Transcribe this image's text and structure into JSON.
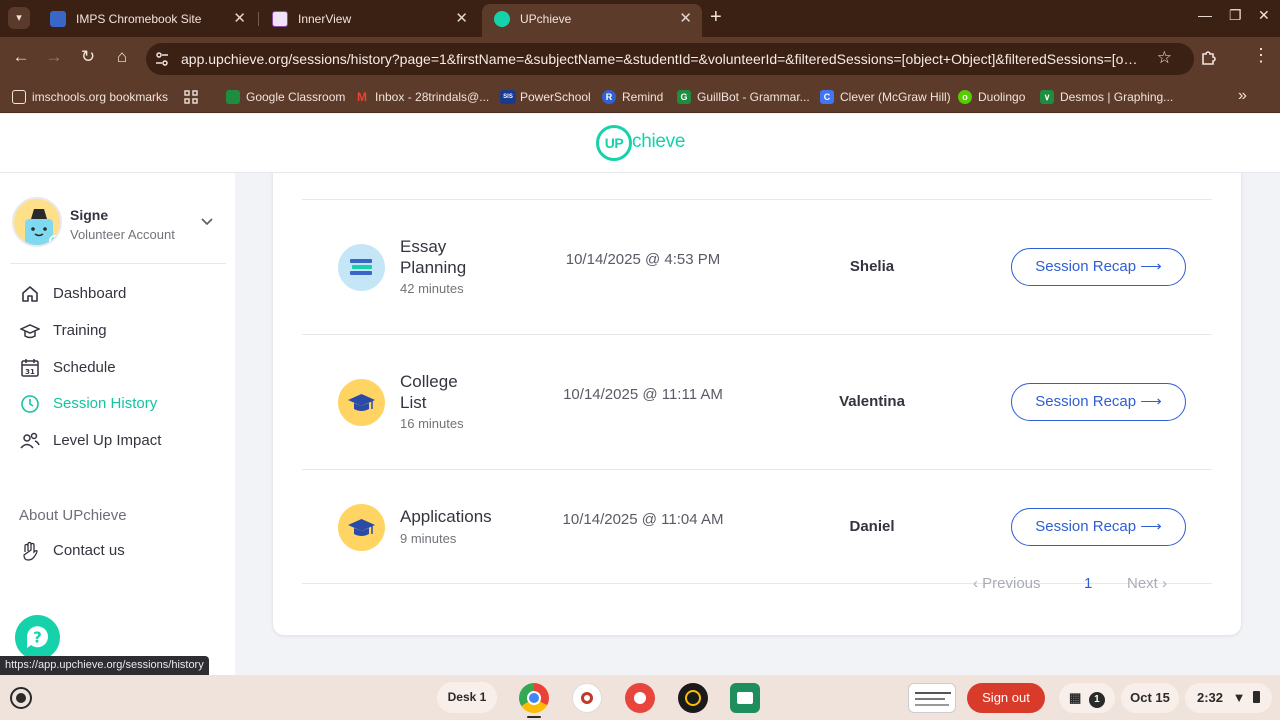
{
  "browser": {
    "tabs": [
      {
        "title": "IMPS Chromebook Site",
        "active": false
      },
      {
        "title": "InnerView",
        "active": false
      },
      {
        "title": "UPchieve",
        "active": true
      }
    ],
    "url": "app.upchieve.org/sessions/history?page=1&firstName=&subjectName=&studentId=&volunteerId=&filteredSessions=[object+Object]&filteredSessions=[object+Obje...",
    "bookmarks": [
      {
        "label": "imschools.org bookmarks",
        "icon": "folder-icon"
      },
      {
        "label": "Google Classroom",
        "icon": "classroom-icon",
        "color": "#1e8e3e"
      },
      {
        "label": "Inbox - 28trindals@...",
        "icon": "gmail-icon",
        "color": "#ea4335"
      },
      {
        "label": "PowerSchool",
        "icon": "powerschool-icon",
        "color": "#1a3a8f"
      },
      {
        "label": "Remind",
        "icon": "remind-icon",
        "color": "#2c62d6"
      },
      {
        "label": "GuillBot - Grammar...",
        "icon": "guillbot-icon",
        "color": "#1e8e3e"
      },
      {
        "label": "Clever (McGraw Hill)",
        "icon": "clever-icon",
        "color": "#4274f6"
      },
      {
        "label": "Duolingo",
        "icon": "duolingo-icon",
        "color": "#58cc02"
      },
      {
        "label": "Desmos | Graphing...",
        "icon": "desmos-icon",
        "color": "#1e8e3e"
      }
    ],
    "status_url": "https://app.upchieve.org/sessions/history"
  },
  "header": {
    "logo_up": "UP",
    "logo_word": "chieve"
  },
  "profile": {
    "name": "Signe",
    "role": "Volunteer Account"
  },
  "nav": [
    {
      "label": "Dashboard",
      "icon": "home-icon",
      "active": false
    },
    {
      "label": "Training",
      "icon": "graduation-cap-icon",
      "active": false
    },
    {
      "label": "Schedule",
      "icon": "calendar-icon",
      "active": false
    },
    {
      "label": "Session History",
      "icon": "clock-icon",
      "active": true
    },
    {
      "label": "Level Up Impact",
      "icon": "people-icon",
      "active": false
    }
  ],
  "about": "About UPchieve",
  "contact": {
    "label": "Contact us",
    "icon": "waving-hand-icon"
  },
  "sessions": [
    {
      "title_line1": "Essay",
      "title_line2": "Planning",
      "duration": "42 minutes",
      "datetime": "10/14/2025 @ 4:53 PM",
      "student": "Shelia",
      "button": "Session Recap ⟶",
      "icon": "books-icon"
    },
    {
      "title_line1": "College",
      "title_line2": "List",
      "duration": "16 minutes",
      "datetime": "10/14/2025 @ 11:11 AM",
      "student": "Valentina",
      "button": "Session Recap ⟶",
      "icon": "grad-cap-icon"
    },
    {
      "title_line1": "Applications",
      "title_line2": "",
      "duration": "9 minutes",
      "datetime": "10/14/2025 @ 11:04 AM",
      "student": "Daniel",
      "button": "Session Recap ⟶",
      "icon": "grad-cap-icon"
    }
  ],
  "pagination": {
    "previous": "‹  Previous",
    "page": "1",
    "next": "Next  ›"
  },
  "shelf": {
    "desk": "Desk 1",
    "signout": "Sign out",
    "notifications": "1",
    "date": "Oct 15",
    "time": "2:32"
  },
  "colors": {
    "brand": "#16d2aa",
    "link": "#2e5fd4",
    "chrome": "#5c3b2b"
  }
}
